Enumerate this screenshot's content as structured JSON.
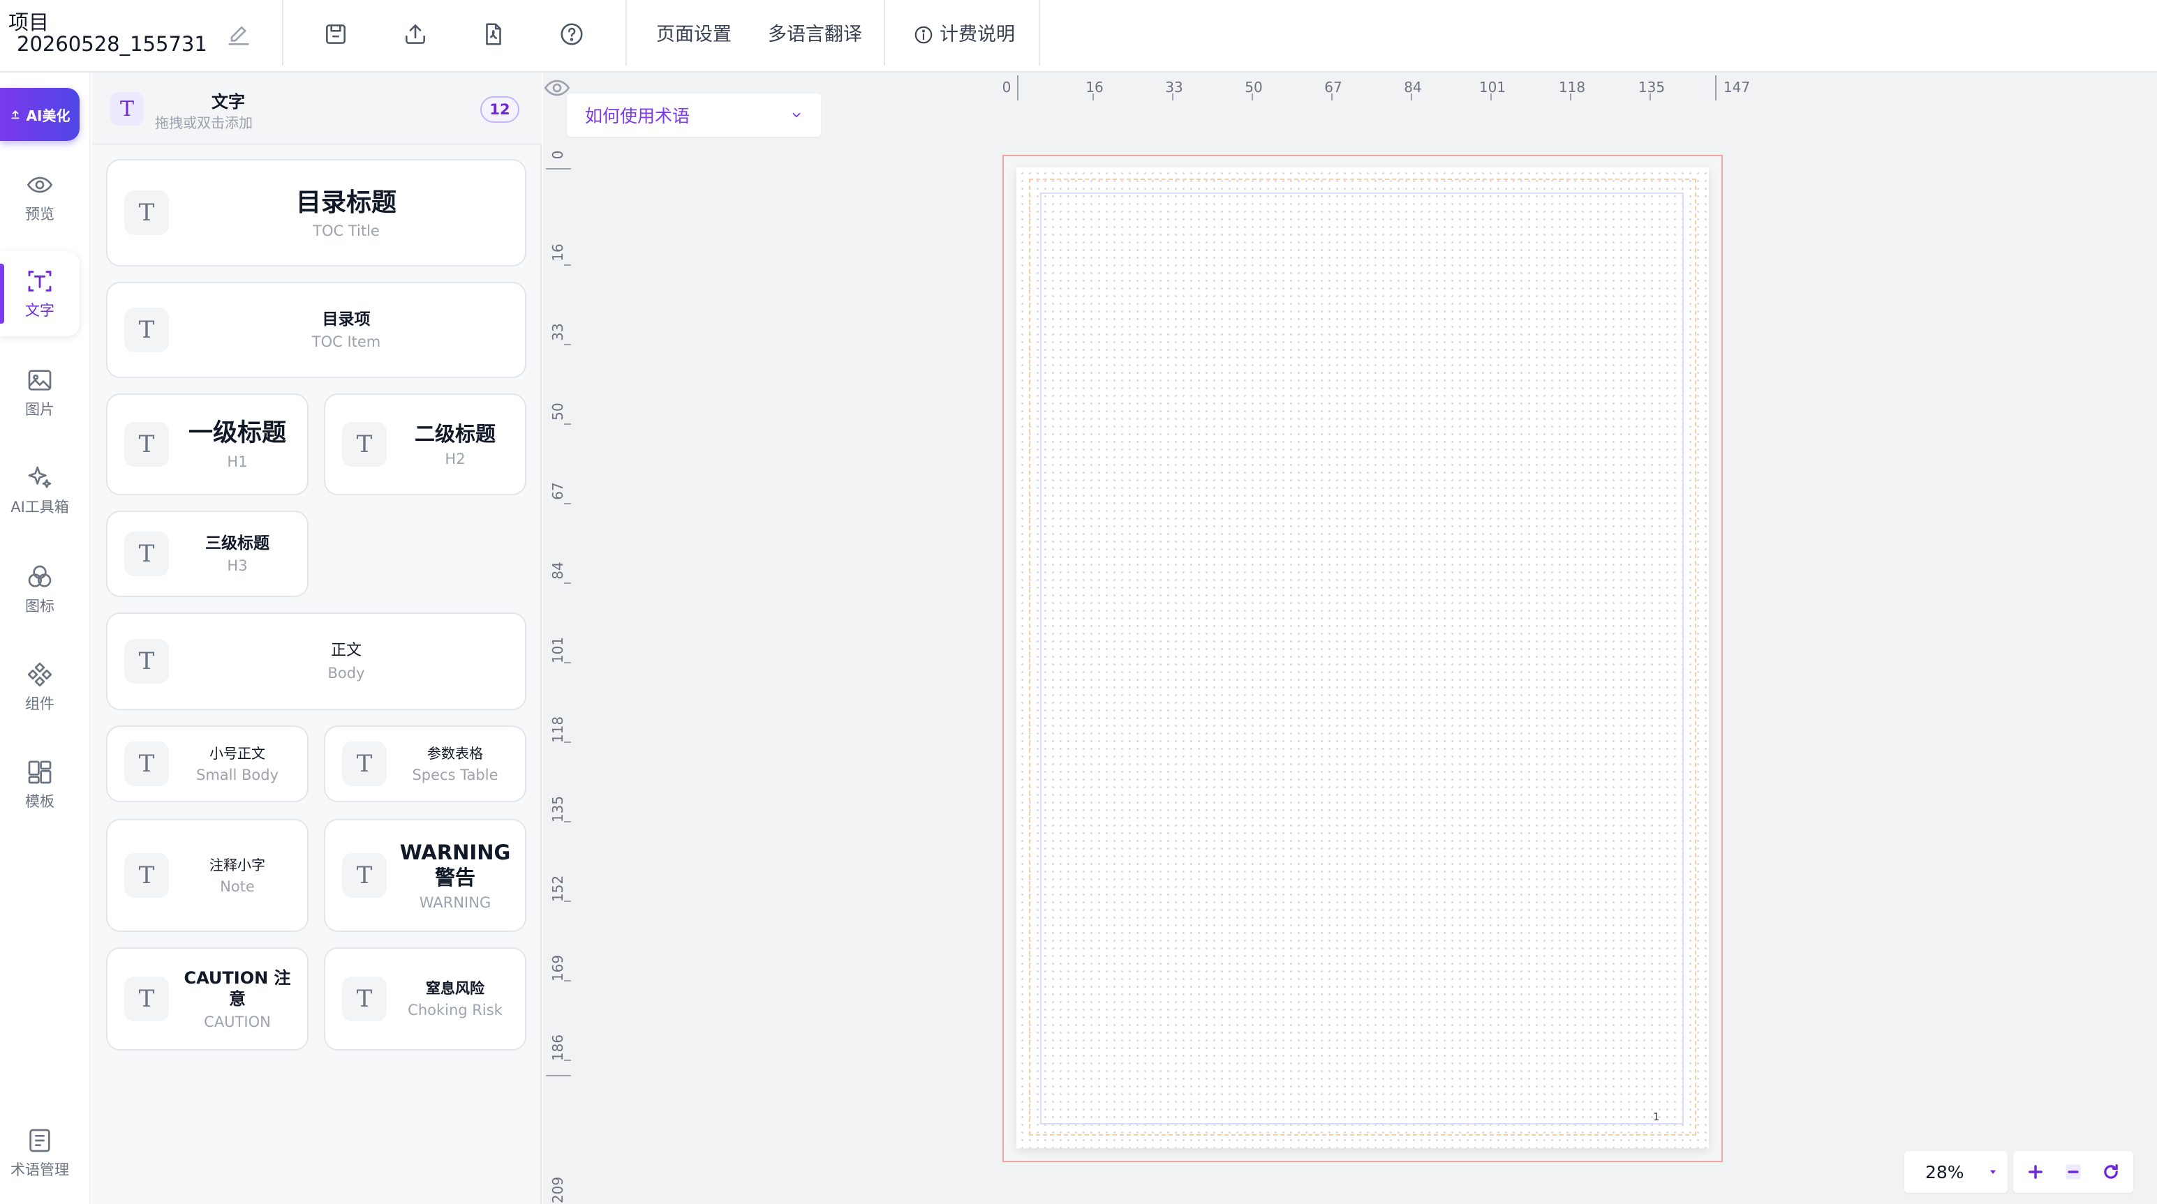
{
  "topbar": {
    "project_label": "项目",
    "project_name": "20260528_155731",
    "page_settings": "页面设置",
    "translate": "多语言翻译",
    "billing": "计费说明"
  },
  "rail": {
    "ai_beautify": "AI美化",
    "preview": "预览",
    "text": "文字",
    "image": "图片",
    "ai_toolbox": "AI工具箱",
    "icons": "图标",
    "components": "组件",
    "templates": "模板",
    "terms": "术语管理"
  },
  "panel": {
    "title": "文字",
    "subtitle": "拖拽或双击添加",
    "count": "12",
    "cards": [
      {
        "main": "目录标题",
        "sub": "TOC Title"
      },
      {
        "main": "目录项",
        "sub": "TOC Item"
      },
      {
        "main": "一级标题",
        "sub": "H1"
      },
      {
        "main": "二级标题",
        "sub": "H2"
      },
      {
        "main": "三级标题",
        "sub": "H3"
      },
      {
        "main": "正文",
        "sub": "Body"
      },
      {
        "main": "小号正文",
        "sub": "Small Body"
      },
      {
        "main": "参数表格",
        "sub": "Specs Table"
      },
      {
        "main": "注释小字",
        "sub": "Note"
      },
      {
        "main": "WARNING 警告",
        "sub": "WARNING"
      },
      {
        "main": "CAUTION 注意",
        "sub": "CAUTION"
      },
      {
        "main": "窒息风险",
        "sub": "Choking Risk"
      }
    ]
  },
  "canvas": {
    "term_select": "如何使用术语",
    "page_number": "1",
    "zoom": "28%",
    "hruler": [
      "0",
      "16",
      "33",
      "50",
      "67",
      "84",
      "101",
      "118",
      "135",
      "147"
    ],
    "vruler": [
      "0",
      "16",
      "33",
      "50",
      "67",
      "84",
      "101",
      "118",
      "135",
      "152",
      "169",
      "186",
      "209"
    ]
  },
  "colors": {
    "accent": "#7c3aed",
    "accent_gradient_end": "#4f46e5",
    "canvas_bg": "#f1f2f3",
    "page_frame": "#f2a3a3"
  },
  "icons": {
    "edit": "pencil-icon",
    "save": "save-icon",
    "upload": "upload-icon",
    "pdf": "pdf-file-icon",
    "help": "help-circle-icon",
    "info": "info-icon"
  }
}
